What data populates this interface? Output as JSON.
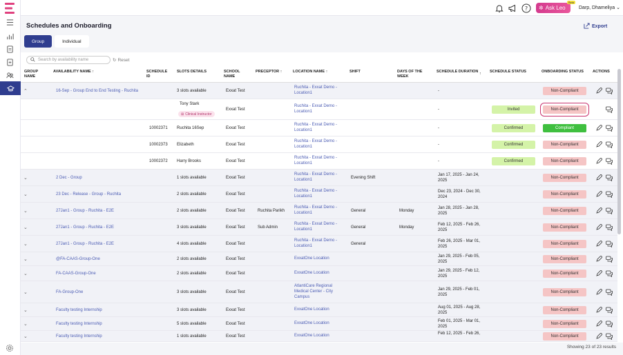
{
  "app": {
    "user": "Darp, Dhameliya",
    "ask_leo": "Ask Leo",
    "ask_leo_badge": "Beta",
    "accent": "#2f3d8f",
    "icons": [
      "bell-icon",
      "megaphone-icon",
      "help-icon",
      "sparkle-icon",
      "chevron-down-icon"
    ]
  },
  "sidebar": {
    "items": [
      "menu-icon",
      "analytics-icon",
      "document-icon",
      "document-plus-icon",
      "users-icon",
      "graduation-cap-icon"
    ],
    "settings": "gear-icon"
  },
  "page": {
    "title": "Schedules and Onboarding",
    "export_label": "Export",
    "tabs": [
      {
        "label": "Group",
        "active": true
      },
      {
        "label": "Individual",
        "active": false
      }
    ],
    "search_placeholder": "Search by availability name",
    "reset_label": "Reset"
  },
  "table": {
    "headers": {
      "group_name": "GROUP NAME",
      "availability_name": "AVAILABILITY NAME",
      "schedule_id": "SCHEDULE ID",
      "slots_details": "SLOTS DETAILS",
      "school_name": "SCHOOL NAME",
      "preceptor": "PRECEPTOR",
      "location_name": "LOCATION NAME",
      "shift": "SHIFT",
      "days_of_week": "DAYS OF THE WEEK",
      "schedule_duration": "SCHEDULE DURATION",
      "schedule_status": "SCHEDULE STATUS",
      "onboarding_status": "ONBOARDING STATUS",
      "actions": "ACTIONS"
    },
    "rows": [
      {
        "kind": "group",
        "expanded": true,
        "availability": "16-Sep - Group End to End Testing - Ruchita",
        "schedule_id": "",
        "slots": "3 slots available",
        "school": "Exxat Test",
        "preceptor": "",
        "location": "Ruchita - Exxat Demo - Location1",
        "shift": "",
        "days": "",
        "duration": "-",
        "schedule_status": "",
        "onboarding": "Non-Compliant"
      },
      {
        "kind": "child",
        "availability": "",
        "schedule_id": "",
        "slots": "Tony Stark",
        "badge": "Clinical Instructor",
        "school": "Exxat Test",
        "preceptor": "",
        "location": "Ruchita - Exxat Demo - Location1",
        "shift": "",
        "days": "",
        "duration": "-",
        "schedule_status": "Invited",
        "onboarding": "Non-Compliant",
        "highlight": true
      },
      {
        "kind": "child",
        "availability": "",
        "schedule_id": "10002371",
        "slots": "Ruchita 16Sep",
        "school": "Exxat Test",
        "preceptor": "",
        "location": "Ruchita - Exxat Demo - Location1",
        "shift": "",
        "days": "",
        "duration": "-",
        "schedule_status": "Confirmed",
        "onboarding": "Compliant"
      },
      {
        "kind": "child",
        "availability": "",
        "schedule_id": "10002373",
        "slots": "Elizabeth",
        "school": "Exxat Test",
        "preceptor": "",
        "location": "Ruchita - Exxat Demo - Location1",
        "shift": "",
        "days": "",
        "duration": "-",
        "schedule_status": "Confirmed",
        "onboarding": "Non-Compliant"
      },
      {
        "kind": "child",
        "availability": "",
        "schedule_id": "10002372",
        "slots": "Harry Brooks",
        "school": "Exxat Test",
        "preceptor": "",
        "location": "Ruchita - Exxat Demo - Location1",
        "shift": "",
        "days": "",
        "duration": "-",
        "schedule_status": "Confirmed",
        "onboarding": "Non-Compliant"
      },
      {
        "kind": "group",
        "expanded": false,
        "availability": "2 Dec - Group",
        "schedule_id": "",
        "slots": "1 slots available",
        "school": "Exxat Test",
        "preceptor": "",
        "location": "Ruchita - Exxat Demo - Location1",
        "shift": "Evening Shift",
        "days": "",
        "duration": "Jan 17, 2025 - Jan 24, 2025",
        "schedule_status": "",
        "onboarding": "Non-Compliant"
      },
      {
        "kind": "group",
        "expanded": false,
        "availability": "23 Dec - Release - Group - Ruchita",
        "schedule_id": "",
        "slots": "2 slots available",
        "school": "Exxat Test",
        "preceptor": "",
        "location": "Ruchita - Exxat Demo - Location1",
        "shift": "",
        "days": "",
        "duration": "Dec 23, 2024 - Dec 30, 2024",
        "schedule_status": "",
        "onboarding": "Non-Compliant"
      },
      {
        "kind": "group",
        "expanded": false,
        "availability": "27Jan1 - Group - Ruchita - E2E",
        "schedule_id": "",
        "slots": "2 slots available",
        "school": "Exxat Test",
        "preceptor": "Ruchita Parikh",
        "location": "Ruchita - Exxat Demo - Location1",
        "shift": "General",
        "days": "Monday",
        "duration": "Jan 28, 2025 - Jan 28, 2025",
        "schedule_status": "",
        "onboarding": "Non-Compliant"
      },
      {
        "kind": "group",
        "expanded": false,
        "availability": "27Jan1 - Group - Ruchita - E2E",
        "schedule_id": "",
        "slots": "3 slots available",
        "school": "Exxat Test",
        "preceptor": "Sub Admin",
        "location": "Ruchita - Exxat Demo - Location1",
        "shift": "General",
        "days": "Monday",
        "duration": "Feb 12, 2025 - Feb 26, 2025",
        "schedule_status": "",
        "onboarding": "Non-Compliant"
      },
      {
        "kind": "group",
        "expanded": false,
        "availability": "27Jan1 - Group - Ruchita - E2E",
        "schedule_id": "",
        "slots": "4 slots available",
        "school": "Exxat Test",
        "preceptor": "",
        "location": "Ruchita - Exxat Demo - Location1",
        "shift": "General",
        "days": "",
        "duration": "Feb 26, 2025 - Mar 01, 2025",
        "schedule_status": "",
        "onboarding": "Non-Compliant"
      },
      {
        "kind": "group",
        "expanded": false,
        "availability": "@FA-CAAS-Group-One",
        "schedule_id": "",
        "slots": "2 slots available",
        "school": "Exxat Test",
        "preceptor": "",
        "location": "ExxatOne Location",
        "shift": "",
        "days": "",
        "duration": "Jan 29, 2025 - Feb 05, 2025",
        "schedule_status": "",
        "onboarding": "Non-Compliant"
      },
      {
        "kind": "group",
        "expanded": false,
        "availability": "FA-CAAS-Group-One",
        "schedule_id": "",
        "slots": "2 slots available",
        "school": "Exxat Test",
        "preceptor": "",
        "location": "ExxatOne Location",
        "shift": "",
        "days": "",
        "duration": "Jan 29, 2025 - Feb 12, 2025",
        "schedule_status": "",
        "onboarding": "Non-Compliant"
      },
      {
        "kind": "group",
        "expanded": false,
        "availability": "FA-Group-One",
        "schedule_id": "",
        "slots": "3 slots available",
        "school": "Exxat Test",
        "preceptor": "",
        "location": "AtlantiCare Regional Medical Center - City Campus",
        "shift": "",
        "days": "",
        "duration": "Jan 29, 2025 - Feb 01, 2025",
        "schedule_status": "",
        "onboarding": "Non-Compliant"
      },
      {
        "kind": "group",
        "expanded": false,
        "availability": "Faculty testing Internship",
        "schedule_id": "",
        "slots": "3 slots available",
        "school": "Exxat Test",
        "preceptor": "",
        "location": "ExxatOne Location",
        "shift": "",
        "days": "",
        "duration": "Aug 01, 2025 - Aug 28, 2025",
        "schedule_status": "",
        "onboarding": "Non-Compliant"
      },
      {
        "kind": "group",
        "expanded": false,
        "availability": "Faculty testing Internship",
        "schedule_id": "",
        "slots": "5 slots available",
        "school": "Exxat Test",
        "preceptor": "",
        "location": "ExxatOne Location",
        "shift": "",
        "days": "",
        "duration": "Feb 01, 2025 - Mar 01, 2025",
        "schedule_status": "",
        "onboarding": "Non-Compliant"
      },
      {
        "kind": "group",
        "expanded": false,
        "availability": "Faculty testing Internship",
        "schedule_id": "",
        "slots": "1 slots available",
        "school": "Exxat Test",
        "preceptor": "",
        "location": "ExxatOne Location",
        "shift": "",
        "days": "",
        "duration": "Feb 12, 2025 - Feb 26,",
        "schedule_status": "",
        "onboarding": "Non-Compliant"
      }
    ]
  },
  "footer": {
    "results": "Showing 23 of 23 results"
  }
}
